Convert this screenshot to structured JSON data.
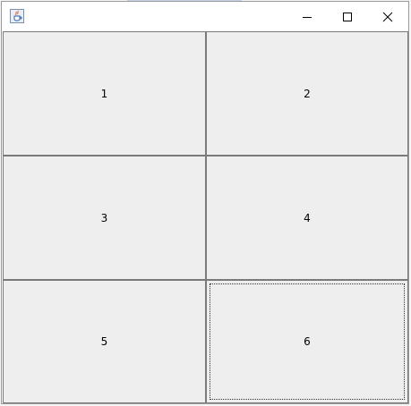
{
  "window": {
    "title": "",
    "icon": "java-coffee-icon",
    "controls": {
      "minimize_icon": "minimize-icon",
      "maximize_icon": "maximize-icon",
      "close_icon": "close-icon"
    }
  },
  "grid": {
    "buttons": [
      {
        "label": "1"
      },
      {
        "label": "2"
      },
      {
        "label": "3"
      },
      {
        "label": "4"
      },
      {
        "label": "5"
      },
      {
        "label": "6",
        "focused": true
      }
    ]
  },
  "colors": {
    "button_face": "#eeeeee",
    "button_border": "#7a7a7a",
    "titlebar": "#ffffff"
  }
}
